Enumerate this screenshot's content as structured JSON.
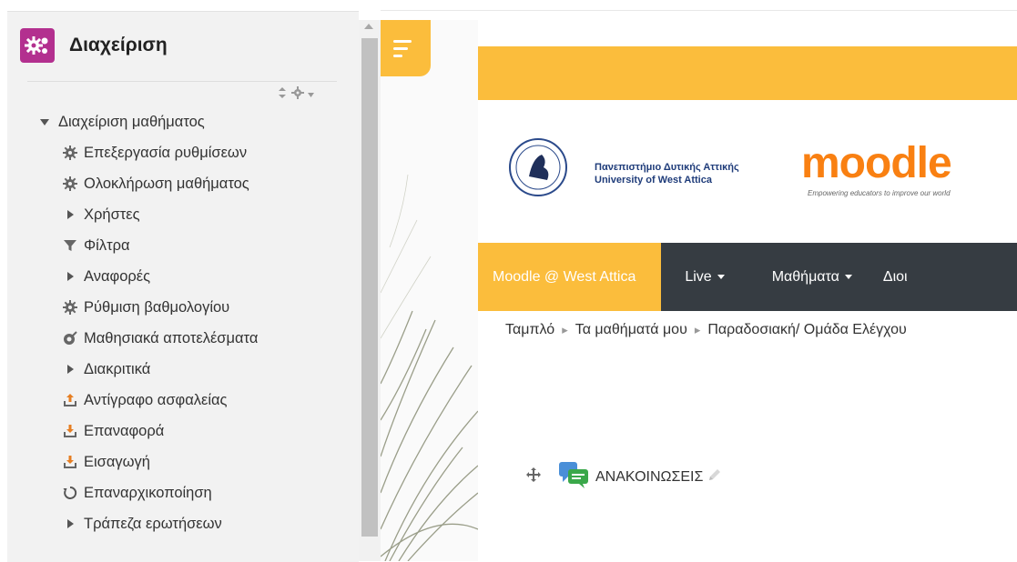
{
  "admin_panel": {
    "title": "Διαχείριση",
    "tree": [
      {
        "label": "Διαχείριση μαθήματος",
        "level": 0,
        "icon": "triangle-down-icon"
      },
      {
        "label": "Επεξεργασία ρυθμίσεων",
        "level": 1,
        "icon": "gear-icon"
      },
      {
        "label": "Ολοκλήρωση μαθήματος",
        "level": 1,
        "icon": "gear-icon"
      },
      {
        "label": "Χρήστες",
        "level": 1,
        "icon": "triangle-right-icon"
      },
      {
        "label": "Φίλτρα",
        "level": 1,
        "icon": "filter-icon"
      },
      {
        "label": "Αναφορές",
        "level": 1,
        "icon": "triangle-right-icon"
      },
      {
        "label": "Ρύθμιση βαθμολογίου",
        "level": 1,
        "icon": "gear-icon"
      },
      {
        "label": "Μαθησιακά αποτελέσματα",
        "level": 1,
        "icon": "outcomes-icon"
      },
      {
        "label": "Διακριτικά",
        "level": 1,
        "icon": "triangle-right-icon"
      },
      {
        "label": "Αντίγραφο ασφαλείας",
        "level": 1,
        "icon": "upload-icon"
      },
      {
        "label": "Επαναφορά",
        "level": 1,
        "icon": "download-icon"
      },
      {
        "label": "Εισαγωγή",
        "level": 1,
        "icon": "download-icon"
      },
      {
        "label": "Επαναρχικοποίηση",
        "level": 1,
        "icon": "reset-icon"
      },
      {
        "label": "Τράπεζα ερωτήσεων",
        "level": 1,
        "icon": "triangle-right-icon"
      }
    ]
  },
  "header": {
    "university_name_gr": "Πανεπιστήμιο Δυτικής Αττικής",
    "university_name_en": "University of West Attica",
    "moodle_logo_text": "moodle",
    "moodle_tagline": "Empowering educators to improve our world"
  },
  "navbar": {
    "home": "Moodle @ West Attica",
    "live": "Live",
    "courses": "Μαθήματα",
    "partial": "Διοι"
  },
  "breadcrumb": [
    "Ταμπλό",
    "Τα μαθήματά μου",
    "Παραδοσιακή/ Ομάδα Ελέγχου"
  ],
  "content": {
    "forum_label": "ΑΝΑΚΟΙΝΩΣΕΙΣ"
  },
  "colors": {
    "accent": "#fbbd3c",
    "admin_icon": "#b3308f",
    "navbar": "#363c42",
    "moodle_orange": "#f98012"
  }
}
